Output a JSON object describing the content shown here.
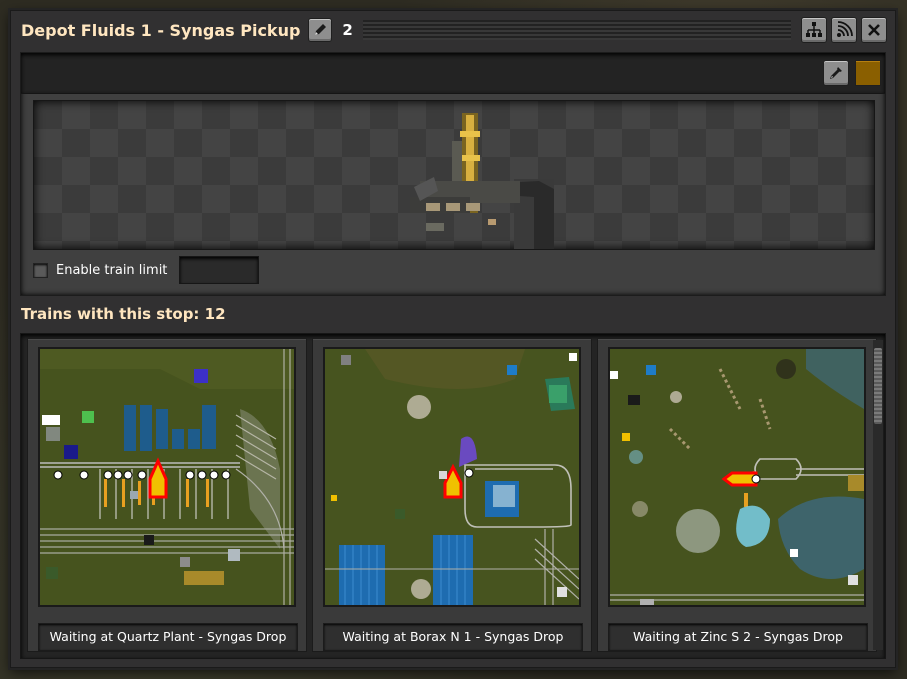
{
  "window": {
    "title": "Depot Fluids 1 - Syngas Pickup",
    "train_count": "2",
    "actions": [
      "network-icon",
      "signal-icon",
      "close-icon"
    ]
  },
  "station": {
    "color": "#8a5f00",
    "enable_limit_label": "Enable train limit",
    "enable_limit_checked": false,
    "limit_value": ""
  },
  "trains": {
    "heading": "Trains with this stop: 12",
    "cards": [
      {
        "status": "Waiting at Quartz Plant - Syngas Drop"
      },
      {
        "status": "Waiting at Borax N 1 - Syngas Drop"
      },
      {
        "status": "Waiting at Zinc S 2 - Syngas Drop"
      }
    ]
  }
}
